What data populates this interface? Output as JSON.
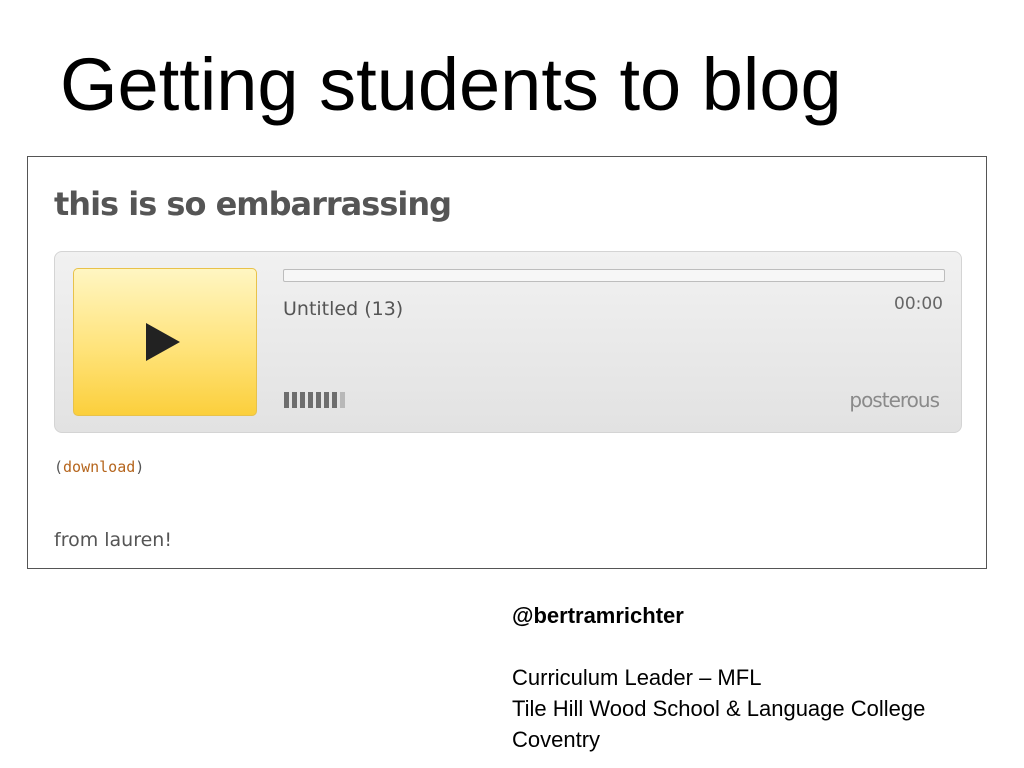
{
  "slide": {
    "title": "Getting students to blog"
  },
  "post": {
    "title": "this is so embarrassing",
    "player": {
      "track_name": "Untitled (13)",
      "time": "00:00",
      "progress_fraction": 0,
      "volume_level": 7,
      "volume_max": 8,
      "play_icon": "play-icon",
      "brand": "posterous",
      "accent_color": "#fbcf3c"
    },
    "download": {
      "open_paren": "(",
      "link_text": "download",
      "close_paren": ")",
      "link_color": "#b5651d"
    },
    "body_text": "from lauren!"
  },
  "author": {
    "handle": "@bertramrichter",
    "role": "Curriculum Leader – MFL",
    "school": "Tile Hill Wood School & Language College",
    "city": "Coventry"
  }
}
